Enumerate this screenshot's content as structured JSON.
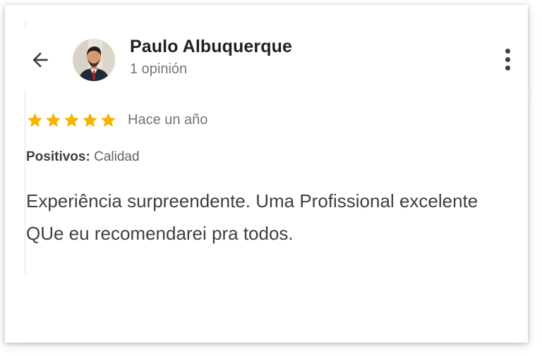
{
  "reviewer": {
    "name": "Paulo Albuquerque",
    "review_count": "1 opinión"
  },
  "rating": {
    "stars": 5,
    "max": 5,
    "star_color": "#f4b400",
    "date": "Hace un año"
  },
  "highlights": {
    "label": "Positivos:",
    "value": "Calidad"
  },
  "review": {
    "text": "Experiência surpreendente. Uma Profissional excelente QUe eu recomendarei pra todos."
  },
  "icons": {
    "back": "arrow-back-icon",
    "more": "more-vertical-icon",
    "star": "star-icon"
  }
}
